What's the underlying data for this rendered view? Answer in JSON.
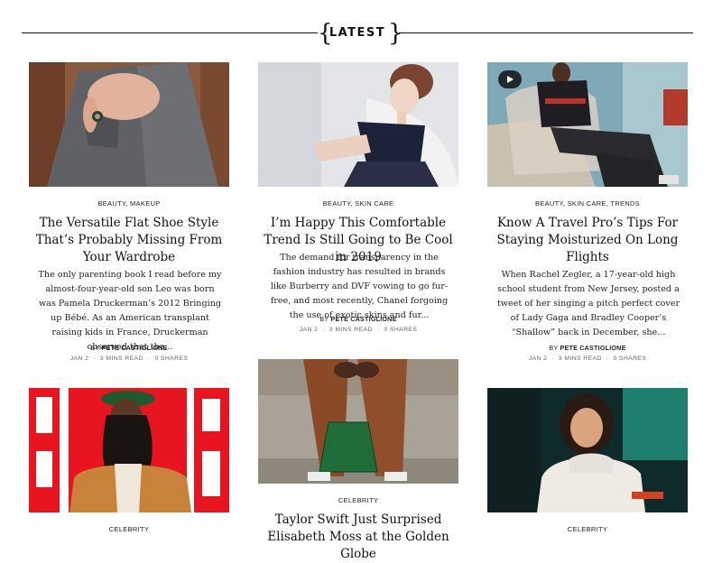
{
  "section": {
    "title": "LATEST"
  },
  "articles": [
    {
      "categories": "BEAUTY, MAKEUP",
      "title": "The Versatile Flat Shoe Style That’s Probably Missing From Your Wardrobe",
      "excerpt": "The only parenting book I read before my almost-four-year-old son Leo was born was Pamela Druckerman’s 2012 Bringing up Bébé. As an American transplant raising kids in France, Druckerman observed that the...",
      "by_prefix": "BY",
      "author": "PETE CASTIGLIONE",
      "date": "JAN 2",
      "read_time": "3 MINS READ",
      "shares": "0 SHARES"
    },
    {
      "categories": "BEAUTY, SKIN CARE",
      "title": "I’m Happy This Comfortable Trend Is Still Going to Be Cool in 2019",
      "excerpt": "The demand for transparency in the fashion industry has resulted in brands like Burberry and DVF vowing to go fur-free, and most recently, Chanel forgoing the use of exotic skins and fur...",
      "by_prefix": "BY",
      "author": "PETE CASTIGLIONE",
      "date": "JAN 2",
      "read_time": "3 MINS READ",
      "shares": "0 SHARES"
    },
    {
      "categories": "BEAUTY, SKIN CARE, TRENDS",
      "title": "Know A Travel Pro’s Tips For Staying Moisturized On Long Flights",
      "excerpt": "When Rachel Zegler, a 17-year-old high school student from New Jersey, posted a tweet of her singing a pitch perfect cover of Lady Gaga and Bradley Cooper’s “Shallow” back in December, she...",
      "by_prefix": "BY",
      "author": "PETE CASTIGLIONE",
      "date": "JAN 2",
      "read_time": "3 MINS READ",
      "shares": "0 SHARES",
      "media": "video-play-icon"
    },
    {
      "categories": "CELEBRITY"
    },
    {
      "categories": "CELEBRITY",
      "title": "Taylor Swift Just Surprised Elisabeth Moss at the Golden Globe"
    },
    {
      "categories": "CELEBRITY"
    }
  ],
  "colors": {
    "text": "#111111",
    "meta": "#666666",
    "rule": "#111111"
  }
}
